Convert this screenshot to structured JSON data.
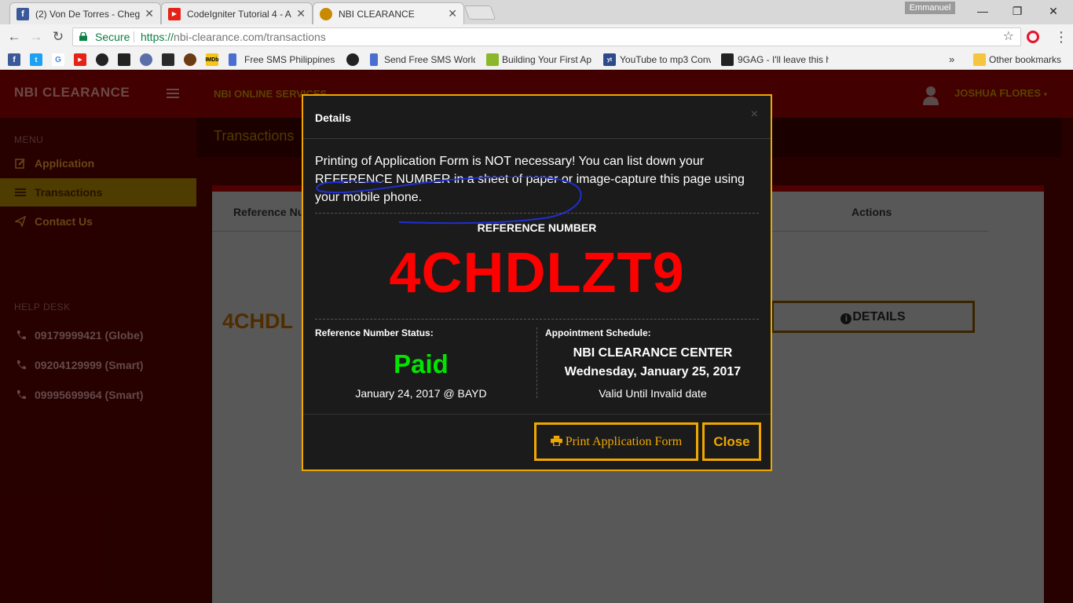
{
  "browser": {
    "tabs": [
      {
        "title": "(2) Von De Torres - Cheg"
      },
      {
        "title": "CodeIgniter Tutorial 4 - A"
      },
      {
        "title": "NBI CLEARANCE"
      }
    ],
    "profile_name": "Emmanuel",
    "omnibox": {
      "secure_label": "Secure",
      "url_scheme": "https://",
      "url_rest": "nbi-clearance.com/transactions"
    },
    "bookmarks": [
      {
        "label": "Free SMS Philippines |"
      },
      {
        "label": "Send Free SMS World"
      },
      {
        "label": "Building Your First Ap"
      },
      {
        "label": "YouTube to mp3 Conv"
      },
      {
        "label": "9GAG - I'll leave this h"
      }
    ],
    "other_bookmarks": "Other bookmarks"
  },
  "sidebar": {
    "brand": "NBI CLEARANCE",
    "menu_heading": "MENU",
    "items": [
      {
        "label": "Application"
      },
      {
        "label": "Transactions"
      },
      {
        "label": "Contact Us"
      }
    ],
    "helpdesk_heading": "HELP DESK",
    "helpdesk": [
      {
        "label": "09179999421 (Globe)"
      },
      {
        "label": "09204129999 (Smart)"
      },
      {
        "label": "09995699964 (Smart)"
      }
    ]
  },
  "topnav": {
    "link": "NBI ONLINE SERVICES",
    "user": "JOSHUA FLORES"
  },
  "page": {
    "title": "Transactions",
    "columns": {
      "reference": "Reference Nu",
      "actions": "Actions"
    },
    "row": {
      "reference": "4CHDL",
      "details_label": "DETAILS"
    }
  },
  "modal": {
    "title": "Details",
    "close_glyph": "×",
    "note": "Printing of Application Form is NOT necessary! You can list down your REFERENCE NUMBER in a sheet of paper or image-capture this page using your mobile phone.",
    "reference_label": "REFERENCE NUMBER",
    "reference_number": "4CHDLZT9",
    "status_label": "Reference Number Status:",
    "status": "Paid",
    "status_date": "January 24, 2017 @ BAYD",
    "schedule_label": "Appointment Schedule:",
    "center": "NBI CLEARANCE CENTER",
    "schedule_date": "Wednesday, January 25, 2017",
    "valid_until": "Valid Until Invalid date",
    "print_button": "Print Application Form",
    "close_button": "Close"
  },
  "colors": {
    "accent": "#f0a800",
    "reference": "#ff0000",
    "paid": "#00e600",
    "brand_bg": "#660000"
  }
}
